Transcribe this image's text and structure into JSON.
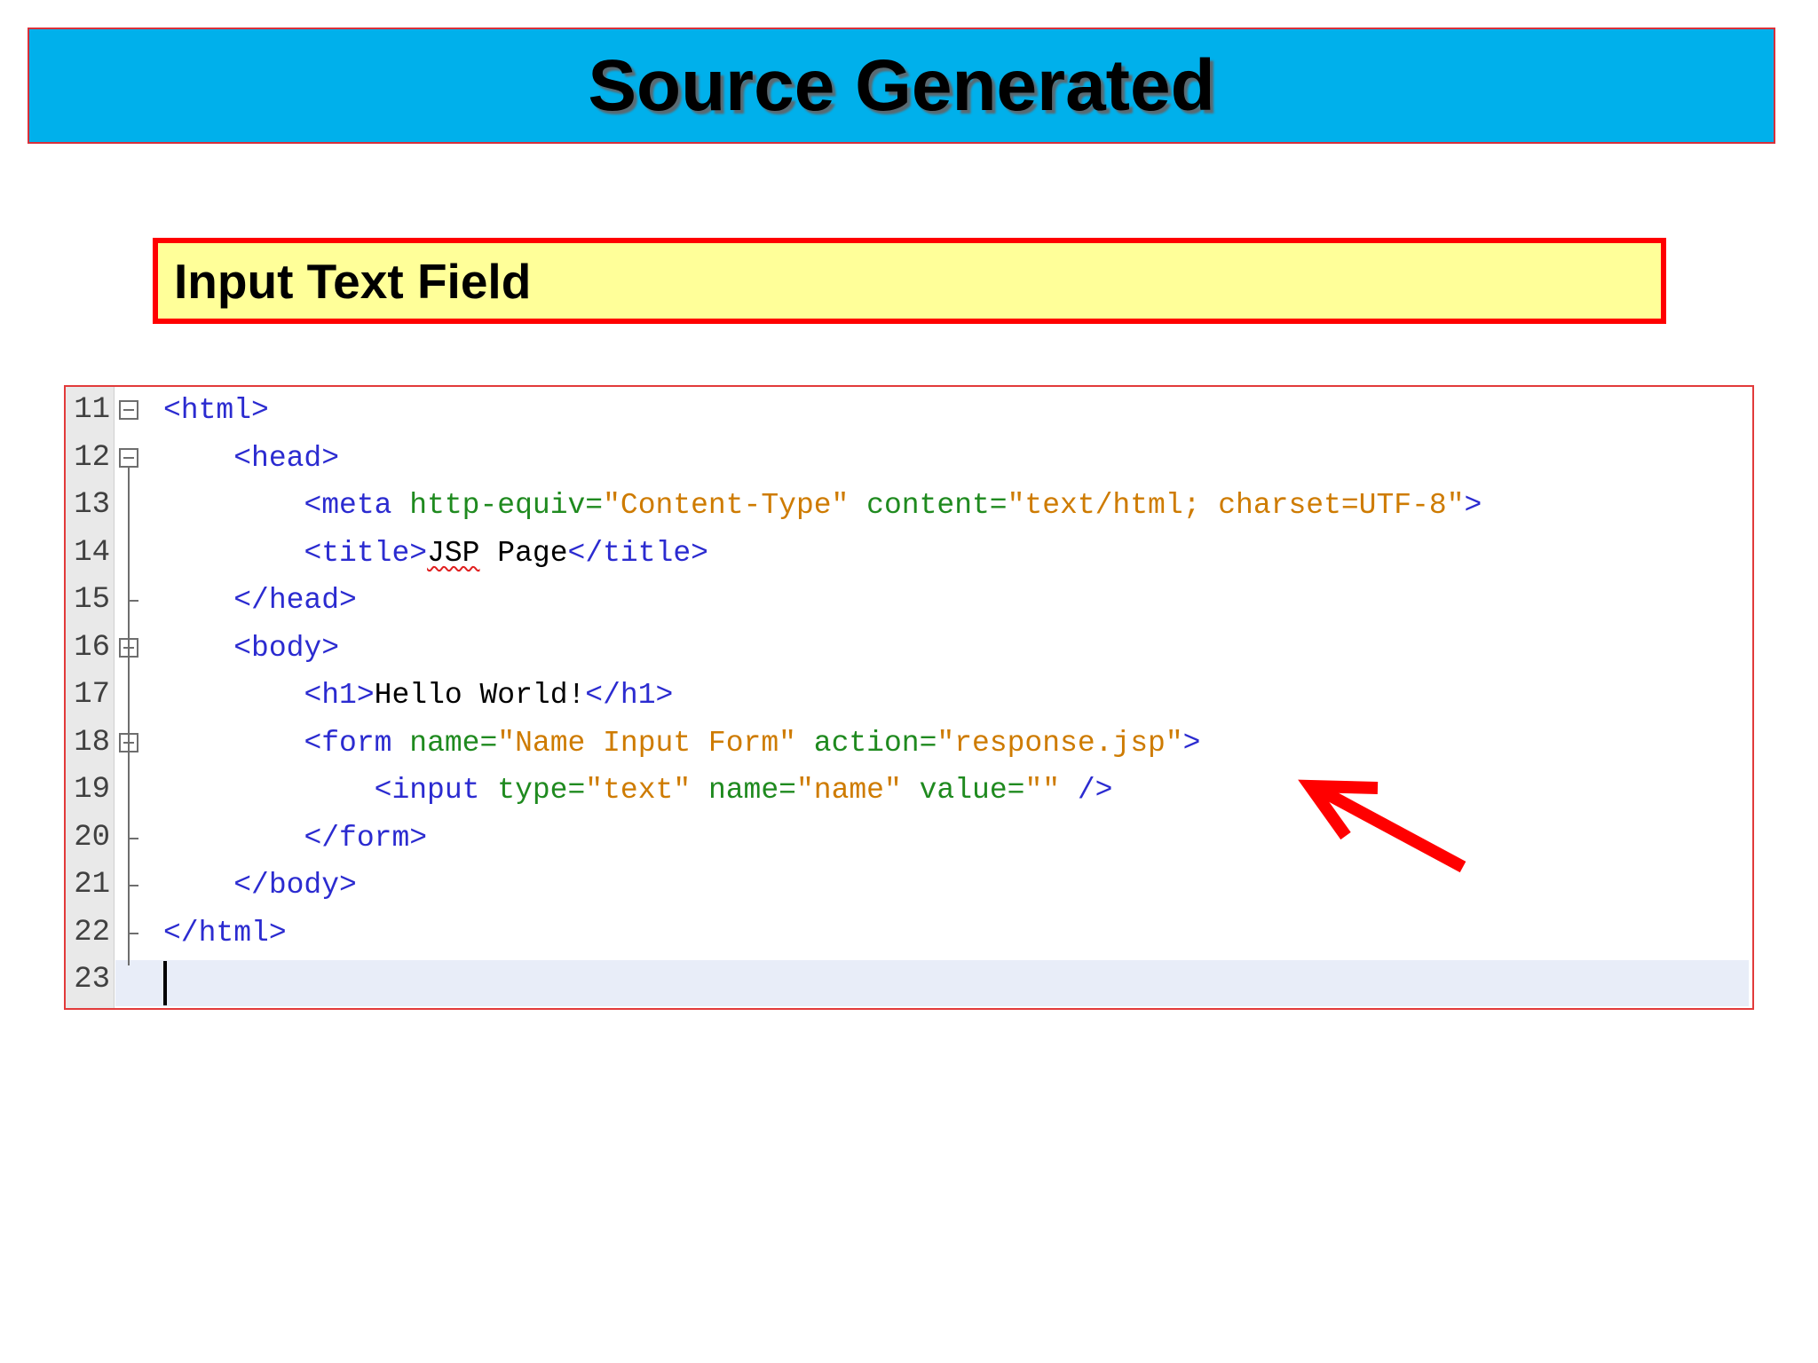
{
  "slide": {
    "title": "Source Generated",
    "subtitle": "Input Text Field"
  },
  "editor": {
    "line_numbers": [
      "11",
      "12",
      "13",
      "14",
      "15",
      "16",
      "17",
      "18",
      "19",
      "20",
      "21",
      "22",
      "23"
    ],
    "lines": [
      {
        "indent": "",
        "tokens": [
          [
            "t",
            "<html>"
          ]
        ]
      },
      {
        "indent": "    ",
        "tokens": [
          [
            "t",
            "<head>"
          ]
        ]
      },
      {
        "indent": "        ",
        "tokens": [
          [
            "t",
            "<meta "
          ],
          [
            "a",
            "http-equiv="
          ],
          [
            "v",
            "\"Content-Type\""
          ],
          [
            "x",
            " "
          ],
          [
            "a",
            "content="
          ],
          [
            "v",
            "\"text/html; charset=UTF-8\""
          ],
          [
            "t",
            ">"
          ]
        ]
      },
      {
        "indent": "        ",
        "tokens": [
          [
            "t",
            "<title>"
          ],
          [
            "s",
            "JSP"
          ],
          [
            "x",
            " Page"
          ],
          [
            "t",
            "</title>"
          ]
        ]
      },
      {
        "indent": "    ",
        "tokens": [
          [
            "t",
            "</head>"
          ]
        ]
      },
      {
        "indent": "    ",
        "tokens": [
          [
            "t",
            "<body>"
          ]
        ]
      },
      {
        "indent": "        ",
        "tokens": [
          [
            "t",
            "<h1>"
          ],
          [
            "x",
            "Hello World!"
          ],
          [
            "t",
            "</h1>"
          ]
        ]
      },
      {
        "indent": "        ",
        "tokens": [
          [
            "t",
            "<form "
          ],
          [
            "a",
            "name="
          ],
          [
            "v",
            "\"Name Input Form\""
          ],
          [
            "x",
            " "
          ],
          [
            "a",
            "action="
          ],
          [
            "v",
            "\"response.jsp\""
          ],
          [
            "t",
            ">"
          ]
        ]
      },
      {
        "indent": "            ",
        "tokens": [
          [
            "t",
            "<input "
          ],
          [
            "a",
            "type="
          ],
          [
            "v",
            "\"text\""
          ],
          [
            "x",
            " "
          ],
          [
            "a",
            "name="
          ],
          [
            "v",
            "\"name\""
          ],
          [
            "x",
            " "
          ],
          [
            "a",
            "value="
          ],
          [
            "v",
            "\"\""
          ],
          [
            "x",
            " "
          ],
          [
            "t",
            "/>"
          ]
        ]
      },
      {
        "indent": "        ",
        "tokens": [
          [
            "t",
            "</form>"
          ]
        ]
      },
      {
        "indent": "    ",
        "tokens": [
          [
            "t",
            "</body>"
          ]
        ]
      },
      {
        "indent": "",
        "tokens": [
          [
            "t",
            "</html>"
          ]
        ]
      },
      {
        "indent": "",
        "tokens": []
      }
    ],
    "current_line": "23"
  },
  "colors": {
    "tag": "#2b2bd0",
    "attribute": "#1f8a1f",
    "value": "#ce7b00",
    "text": "#000000",
    "title_bar": "#00b0eb",
    "subtitle_box": "#ffff99",
    "arrow": "#ff0000"
  },
  "icons": [
    "fold-collapse-icon",
    "arrow-pointer-icon"
  ]
}
